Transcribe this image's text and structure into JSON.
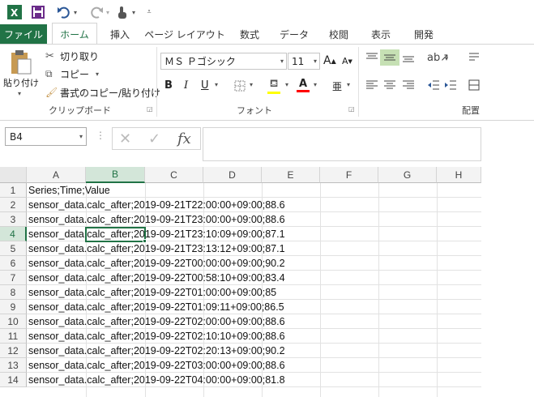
{
  "qat": {
    "icons": [
      "excel-logo",
      "save",
      "undo",
      "redo",
      "touch-mode",
      "customize"
    ]
  },
  "tabs": {
    "file": "ファイル",
    "items": [
      "ホーム",
      "挿入",
      "ページ レイアウト",
      "数式",
      "データ",
      "校閲",
      "表示",
      "開発"
    ]
  },
  "ribbon": {
    "clipboard": {
      "paste": "貼り付け",
      "cut": "切り取り",
      "copy": "コピー",
      "format_painter": "書式のコピー/貼り付け",
      "label": "クリップボード"
    },
    "font": {
      "name": "ＭＳ Ｐゴシック",
      "size": "11",
      "label": "フォント",
      "grow": "A",
      "shrink": "A",
      "bold": "B",
      "italic": "I",
      "underline": "U",
      "font_color_letter": "A",
      "phonetic": "亜"
    },
    "alignment": {
      "label": "配置"
    }
  },
  "formula": {
    "name_box": "B4",
    "fx": "fx",
    "value": ""
  },
  "columns": [
    "A",
    "B",
    "C",
    "D",
    "E",
    "F",
    "G",
    "H"
  ],
  "rows": [
    {
      "num": "1",
      "text": "Series;Time;Value"
    },
    {
      "num": "2",
      "text": "sensor_data.calc_after;2019-09-21T22:00:00+09:00;88.6"
    },
    {
      "num": "3",
      "text": "sensor_data.calc_after;2019-09-21T23:00:00+09:00;88.6"
    },
    {
      "num": "4",
      "text": "sensor_data.calc_after;2019-09-21T23:10:09+09:00;87.1"
    },
    {
      "num": "5",
      "text": "sensor_data.calc_after;2019-09-21T23:13:12+09:00;87.1"
    },
    {
      "num": "6",
      "text": "sensor_data.calc_after;2019-09-22T00:00:00+09:00;90.2"
    },
    {
      "num": "7",
      "text": "sensor_data.calc_after;2019-09-22T00:58:10+09:00;83.4"
    },
    {
      "num": "8",
      "text": "sensor_data.calc_after;2019-09-22T01:00:00+09:00;85"
    },
    {
      "num": "9",
      "text": "sensor_data.calc_after;2019-09-22T01:09:11+09:00;86.5"
    },
    {
      "num": "10",
      "text": "sensor_data.calc_after;2019-09-22T02:00:00+09:00;88.6"
    },
    {
      "num": "11",
      "text": "sensor_data.calc_after;2019-09-22T02:10:10+09:00;88.6"
    },
    {
      "num": "12",
      "text": "sensor_data.calc_after;2019-09-22T02:20:13+09:00;90.2"
    },
    {
      "num": "13",
      "text": "sensor_data.calc_after;2019-09-22T03:00:00+09:00;88.6"
    },
    {
      "num": "14",
      "text": "sensor_data.calc_after;2019-09-22T04:00:00+09:00;81.8"
    }
  ],
  "colors": {
    "accent": "#217346",
    "header_bg": "#f3f3f3",
    "selection": "#217346",
    "fill_yellow": "#ffff00",
    "font_red": "#ff0000"
  }
}
